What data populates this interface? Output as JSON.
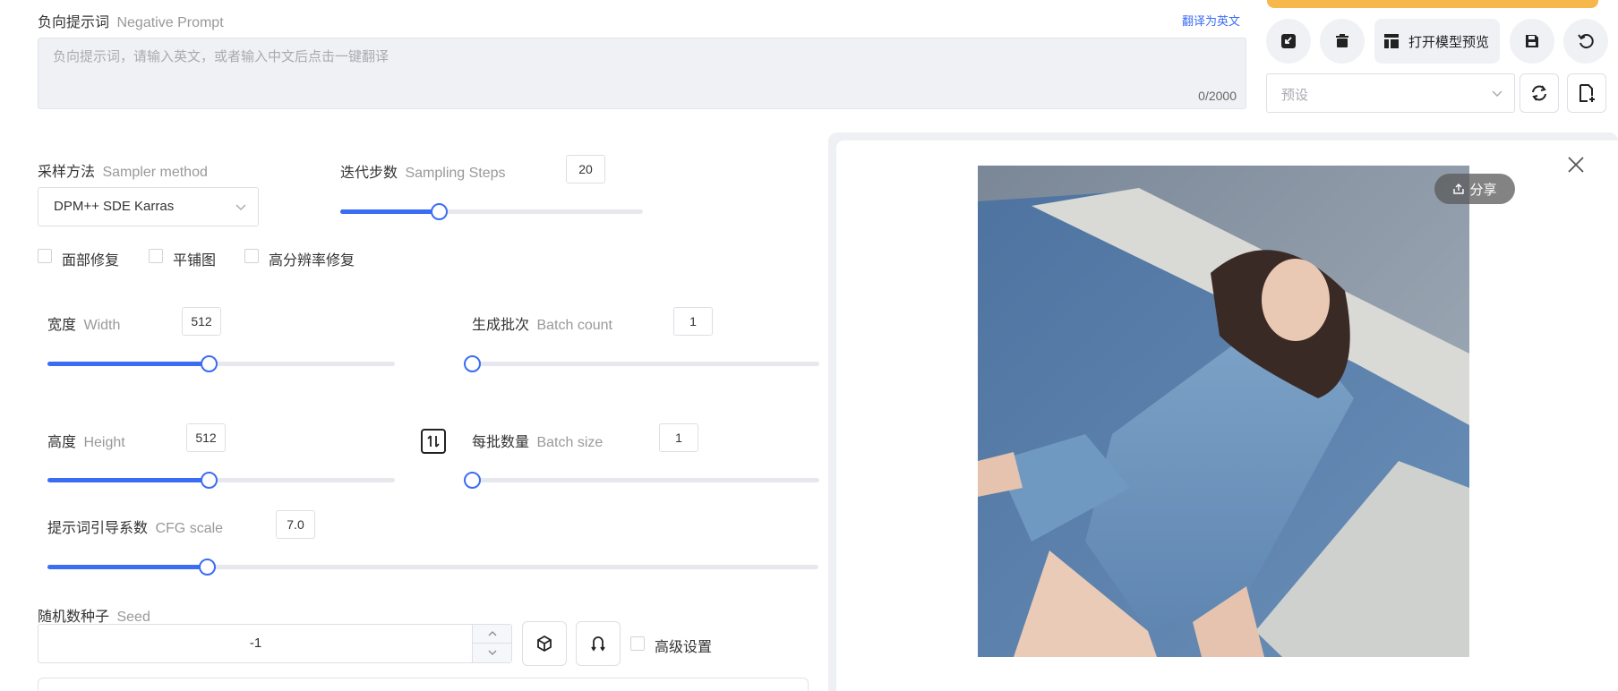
{
  "negative_prompt": {
    "label_cn": "负向提示词",
    "label_en": "Negative Prompt",
    "translate_link": "翻译为英文",
    "placeholder": "负向提示词，请输入英文，或者输入中文后点击一键翻译",
    "counter": "0/2000"
  },
  "sampler": {
    "label_cn": "采样方法",
    "label_en": "Sampler method",
    "value": "DPM++ SDE Karras"
  },
  "steps": {
    "label_cn": "迭代步数",
    "label_en": "Sampling Steps",
    "value": "20",
    "fraction": 0.325
  },
  "checkboxes": {
    "face_restore": "面部修复",
    "tiling": "平铺图",
    "hires_fix": "高分辨率修复"
  },
  "width": {
    "label_cn": "宽度",
    "label_en": "Width",
    "value": "512",
    "fraction": 0.465
  },
  "batch_count": {
    "label_cn": "生成批次",
    "label_en": "Batch count",
    "value": "1",
    "fraction": 0.0
  },
  "height": {
    "label_cn": "高度",
    "label_en": "Height",
    "value": "512",
    "fraction": 0.465
  },
  "batch_size": {
    "label_cn": "每批数量",
    "label_en": "Batch size",
    "value": "1",
    "fraction": 0.0
  },
  "cfg": {
    "label_cn": "提示词引导系数",
    "label_en": "CFG scale",
    "value": "7.0",
    "fraction": 0.207
  },
  "seed": {
    "label_cn": "随机数种子",
    "label_en": "Seed",
    "value": "-1",
    "advanced_label": "高级设置"
  },
  "toolbar": {
    "open_preview_label": "打开模型预览",
    "preset_placeholder": "预设"
  },
  "preview": {
    "share_label": "分享"
  },
  "colors": {
    "accent": "#3a6cf4",
    "orange": "#f7b84b",
    "link": "#3a6cf4"
  }
}
